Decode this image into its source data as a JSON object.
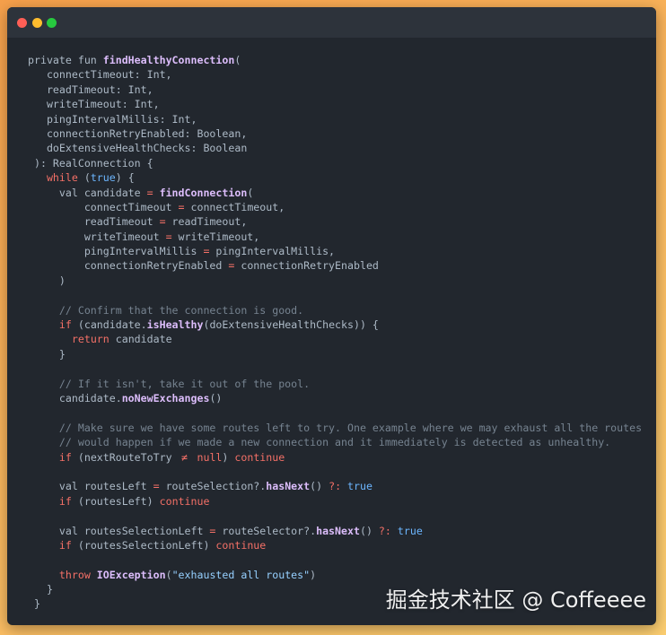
{
  "colors": {
    "page_gradient_start": "#f6a04b",
    "page_gradient_end": "#fbcd70",
    "window": "#22272e",
    "titlebar": "#2d333b"
  },
  "syntax_colors": {
    "plain": "#adbac7",
    "keyword": "#f47067",
    "constant": "#6cb6ff",
    "string": "#96d0ff",
    "comment": "#768390",
    "function": "#dcbdfb"
  },
  "window": {
    "controls": [
      {
        "icon": "close",
        "color": "#ff5f56"
      },
      {
        "icon": "minimize",
        "color": "#ffbd2e"
      },
      {
        "icon": "zoom",
        "color": "#27c93f"
      }
    ]
  },
  "code": {
    "lines": [
      [
        {
          "plain": "private fun "
        },
        {
          "function": "findHealthyConnection"
        },
        {
          "plain": "("
        }
      ],
      [
        {
          "plain": "   connectTimeout: Int,"
        }
      ],
      [
        {
          "plain": "   readTimeout: Int,"
        }
      ],
      [
        {
          "plain": "   writeTimeout: Int,"
        }
      ],
      [
        {
          "plain": "   pingIntervalMillis: Int,"
        }
      ],
      [
        {
          "plain": "   connectionRetryEnabled: Boolean,"
        }
      ],
      [
        {
          "plain": "   doExtensiveHealthChecks: Boolean"
        }
      ],
      [
        {
          "plain": " ): RealConnection {"
        }
      ],
      [
        {
          "plain": "   "
        },
        {
          "keyword": "while"
        },
        {
          "plain": " ("
        },
        {
          "constant": "true"
        },
        {
          "plain": ") {"
        }
      ],
      [
        {
          "plain": "     val candidate "
        },
        {
          "keyword": "="
        },
        {
          "plain": " "
        },
        {
          "function": "findConnection"
        },
        {
          "plain": "("
        }
      ],
      [
        {
          "plain": "         connectTimeout "
        },
        {
          "keyword": "="
        },
        {
          "plain": " connectTimeout,"
        }
      ],
      [
        {
          "plain": "         readTimeout "
        },
        {
          "keyword": "="
        },
        {
          "plain": " readTimeout,"
        }
      ],
      [
        {
          "plain": "         writeTimeout "
        },
        {
          "keyword": "="
        },
        {
          "plain": " writeTimeout,"
        }
      ],
      [
        {
          "plain": "         pingIntervalMillis "
        },
        {
          "keyword": "="
        },
        {
          "plain": " pingIntervalMillis,"
        }
      ],
      [
        {
          "plain": "         connectionRetryEnabled "
        },
        {
          "keyword": "="
        },
        {
          "plain": " connectionRetryEnabled"
        }
      ],
      [
        {
          "plain": "     )"
        }
      ],
      [],
      [
        {
          "plain": "     "
        },
        {
          "comment": "// Confirm that the connection is good."
        }
      ],
      [
        {
          "plain": "     "
        },
        {
          "keyword": "if"
        },
        {
          "plain": " (candidate."
        },
        {
          "function": "isHealthy"
        },
        {
          "plain": "(doExtensiveHealthChecks)) {"
        }
      ],
      [
        {
          "plain": "       "
        },
        {
          "keyword": "return"
        },
        {
          "plain": " candidate"
        }
      ],
      [
        {
          "plain": "     }"
        }
      ],
      [],
      [
        {
          "plain": "     "
        },
        {
          "comment": "// If it isn't, take it out of the pool."
        }
      ],
      [
        {
          "plain": "     candidate."
        },
        {
          "function": "noNewExchanges"
        },
        {
          "plain": "()"
        }
      ],
      [],
      [
        {
          "plain": "     "
        },
        {
          "comment": "// Make sure we have some routes left to try. One example where we may exhaust all the routes"
        }
      ],
      [
        {
          "plain": "     "
        },
        {
          "comment": "// would happen if we made a new connection and it immediately is detected as unhealthy."
        }
      ],
      [
        {
          "plain": "     "
        },
        {
          "keyword": "if"
        },
        {
          "plain": " (nextRouteToTry "
        },
        {
          "keyword": "≠"
        },
        {
          "plain": " "
        },
        {
          "keyword": "null"
        },
        {
          "plain": ") "
        },
        {
          "keyword": "continue"
        }
      ],
      [],
      [
        {
          "plain": "     val routesLeft "
        },
        {
          "keyword": "="
        },
        {
          "plain": " routeSelection?."
        },
        {
          "function": "hasNext"
        },
        {
          "plain": "() "
        },
        {
          "keyword": "?:"
        },
        {
          "plain": " "
        },
        {
          "constant": "true"
        }
      ],
      [
        {
          "plain": "     "
        },
        {
          "keyword": "if"
        },
        {
          "plain": " (routesLeft) "
        },
        {
          "keyword": "continue"
        }
      ],
      [],
      [
        {
          "plain": "     val routesSelectionLeft "
        },
        {
          "keyword": "="
        },
        {
          "plain": " routeSelector?."
        },
        {
          "function": "hasNext"
        },
        {
          "plain": "() "
        },
        {
          "keyword": "?:"
        },
        {
          "plain": " "
        },
        {
          "constant": "true"
        }
      ],
      [
        {
          "plain": "     "
        },
        {
          "keyword": "if"
        },
        {
          "plain": " (routesSelectionLeft) "
        },
        {
          "keyword": "continue"
        }
      ],
      [],
      [
        {
          "plain": "     "
        },
        {
          "keyword": "throw"
        },
        {
          "plain": " "
        },
        {
          "function": "IOException"
        },
        {
          "plain": "("
        },
        {
          "string": "\"exhausted all routes\""
        },
        {
          "plain": ")"
        }
      ],
      [
        {
          "plain": "   }"
        }
      ],
      [
        {
          "plain": " }"
        }
      ]
    ]
  },
  "watermark": "掘金技术社区 @ Coffeeee"
}
